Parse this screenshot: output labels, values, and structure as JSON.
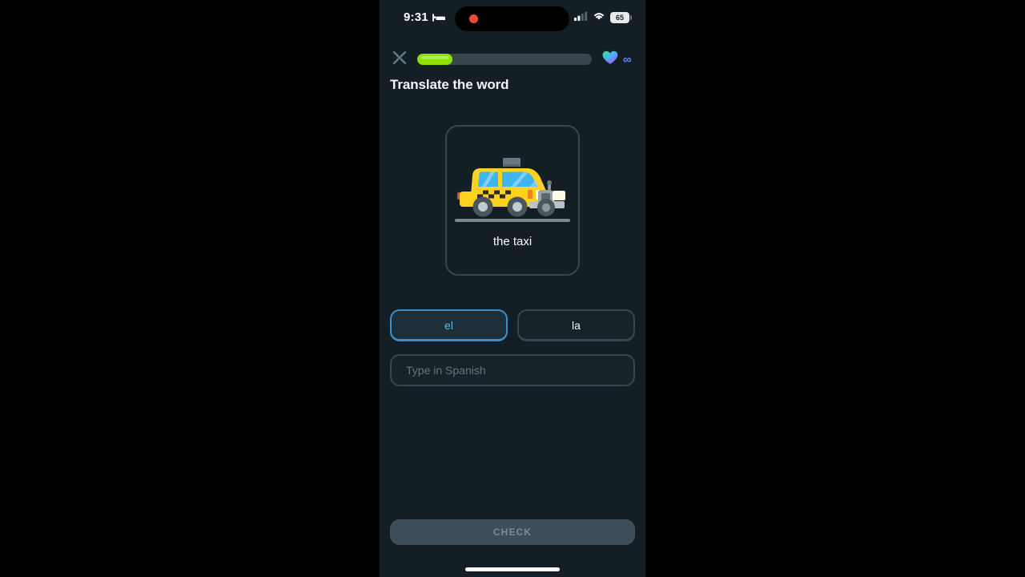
{
  "meta": {
    "app": "Duolingo lesson screen",
    "accent_green": "#8ee000",
    "accent_blue": "#60b8e8",
    "background": "#131f24",
    "border_slate": "#37464f"
  },
  "status_bar": {
    "time": "9:31",
    "sleep_icon": "bed-icon",
    "recording_indicator": "record-dot-icon",
    "cellular_icon": "signal-bars-icon",
    "wifi_icon": "wifi-icon",
    "battery_level": "65"
  },
  "header": {
    "close_label": "close-icon",
    "progress_percent": 20,
    "hearts_icon": "heart-icon",
    "hearts_value": "∞"
  },
  "exercise": {
    "prompt": "Translate the word",
    "card": {
      "image": "taxi-illustration",
      "label": "the taxi"
    },
    "choices": [
      {
        "label": "el",
        "selected": true
      },
      {
        "label": "la",
        "selected": false
      }
    ],
    "input": {
      "placeholder": "Type in Spanish",
      "value": ""
    },
    "submit_label": "CHECK",
    "submit_enabled": false
  }
}
